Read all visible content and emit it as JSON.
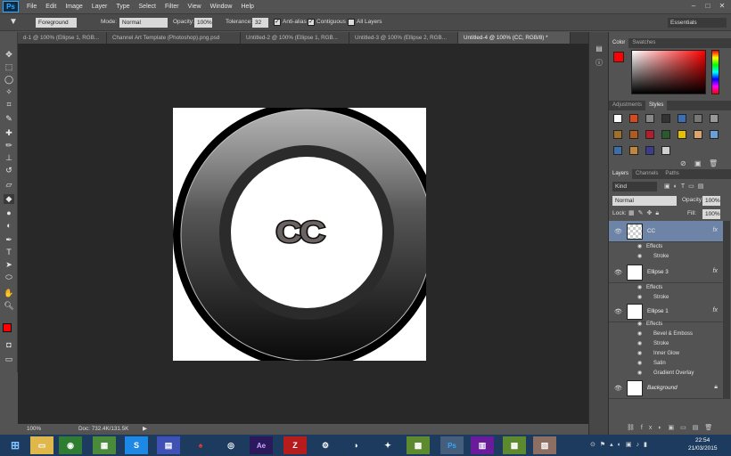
{
  "app": {
    "logo": "Ps"
  },
  "menu": [
    "File",
    "Edit",
    "Image",
    "Layer",
    "Type",
    "Select",
    "Filter",
    "View",
    "Window",
    "Help"
  ],
  "window_controls": [
    "minimize-icon",
    "restore-icon",
    "close-icon"
  ],
  "options": {
    "sample_label": "Foreground",
    "mode_label": "Mode:",
    "mode_value": "Normal",
    "opacity_label": "Opacity:",
    "opacity_value": "100%",
    "tolerance_label": "Tolerance:",
    "tolerance_value": "32",
    "antialias_label": "Anti-alias",
    "contiguous_label": "Contiguous",
    "all_layers_label": "All Layers",
    "workspace": "Essentials"
  },
  "tabs": [
    "d-1 @ 100% (Ellipse 1, RGB...",
    "Channel Art Template (Photoshop).png.psd",
    "Untitled-2 @ 100% (Ellipse 1, RGB...",
    "Untitled-3 @ 100% (Ellipse 2, RGB...",
    "Untitled-4 @ 100% (CC, RGB/8) *"
  ],
  "canvas": {
    "text": "CC"
  },
  "status": {
    "zoom": "100%",
    "doc": "Doc: 732.4K/131.5K"
  },
  "color_panel": {
    "tabs": [
      "Color",
      "Swatches"
    ],
    "fg": "#ff0000",
    "bg": "#ffffff"
  },
  "styles_panel": {
    "tabs": [
      "Adjustments",
      "Styles"
    ]
  },
  "layers_panel": {
    "tabs": [
      "Layers",
      "Channels",
      "Paths"
    ],
    "kind_label": "Kind",
    "blend_mode": "Normal",
    "opacity_label": "Opacity:",
    "opacity_value": "100%",
    "lock_label": "Lock:",
    "fill_label": "Fill:",
    "fill_value": "100%",
    "layers": [
      {
        "name": "CC",
        "effects_label": "Effects",
        "effects": [
          "Stroke"
        ]
      },
      {
        "name": "Ellipse 3",
        "effects_label": "Effects",
        "effects": [
          "Stroke"
        ]
      },
      {
        "name": "Ellipse 1",
        "effects_label": "Effects",
        "effects": [
          "Bevel & Emboss",
          "Stroke",
          "Inner Glow",
          "Satin",
          "Gradient Overlay"
        ]
      },
      {
        "name": "Background"
      }
    ]
  },
  "taskbar": {
    "time": "22:54",
    "date": "21/03/2015"
  }
}
